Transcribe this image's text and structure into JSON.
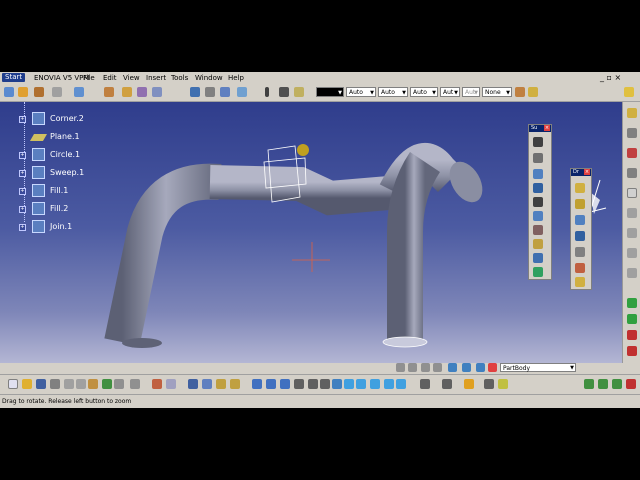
{
  "menu": {
    "start": "Start",
    "enovia": "ENOVIA V5 VPM",
    "file": "File",
    "edit": "Edit",
    "view": "View",
    "insert": "Insert",
    "tools": "Tools",
    "window": "Window",
    "help": "Help",
    "window_controls": "_ ▫ ×"
  },
  "toolbar": {
    "color_combo": "",
    "transparency_combo": "Auto",
    "linetype_combo": "Auto",
    "thickness_combo": "Auto",
    "linewidth_combo": "Aut",
    "layer_combo": "Aut",
    "none_combo": "None"
  },
  "tree": {
    "items": [
      {
        "label": "Corner.2",
        "icon": "corner-icon"
      },
      {
        "label": "Plane.1",
        "icon": "plane-icon"
      },
      {
        "label": "Circle.1",
        "icon": "circle-icon"
      },
      {
        "label": "Sweep.1",
        "icon": "sweep-icon"
      },
      {
        "label": "Fill.1",
        "icon": "fill-icon"
      },
      {
        "label": "Fill.2",
        "icon": "fill-icon"
      },
      {
        "label": "Join.1",
        "icon": "join-icon"
      }
    ]
  },
  "palettes": {
    "left_title": "Su",
    "right_title": "Dr"
  },
  "bottom": {
    "partbody": "PartBody"
  },
  "status": {
    "message": "Drag to rotate. Release left button to zoom"
  },
  "colors": {
    "viewport_top": "#2f3d8c",
    "viewport_bottom": "#c8c8de",
    "pipe": "#8e92a6",
    "tree_text": "#ffffff"
  }
}
